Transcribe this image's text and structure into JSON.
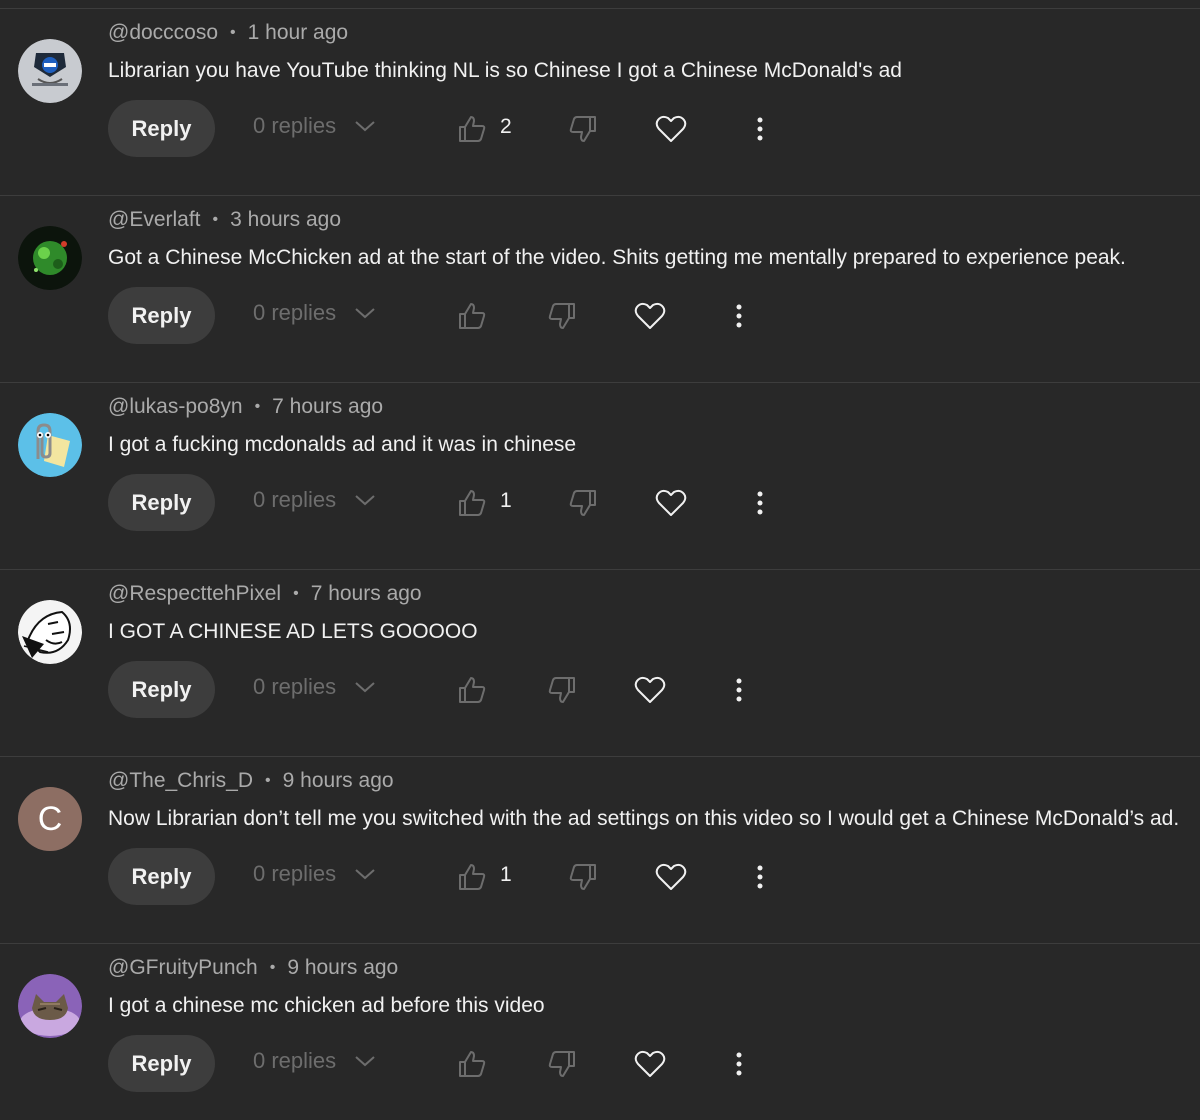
{
  "comments": [
    {
      "avatar_icon": "captain-badge-avatar-icon",
      "username": "@docccoso",
      "separator": "•",
      "time": "1 hour ago",
      "text": "Librarian you have YouTube thinking NL is so Chinese I got a Chinese McDonald's ad",
      "reply_label": "Reply",
      "replies_label": "0 replies",
      "likes": "2"
    },
    {
      "avatar_icon": "green-planet-avatar-icon",
      "username": "@Everlaft",
      "separator": "•",
      "time": "3 hours ago",
      "text": "Got a Chinese McChicken ad at the start of the video. Shits getting me mentally prepared to experience peak.",
      "reply_label": "Reply",
      "replies_label": "0 replies",
      "likes": ""
    },
    {
      "avatar_icon": "paperclip-avatar-icon",
      "username": "@lukas-po8yn",
      "separator": "•",
      "time": "7 hours ago",
      "text": "I got a fucking mcdonalds ad and it was in chinese",
      "reply_label": "Reply",
      "replies_label": "0 replies",
      "likes": "1"
    },
    {
      "avatar_icon": "sketch-face-avatar-icon",
      "username": "@RespecttehPixel",
      "separator": "•",
      "time": "7 hours ago",
      "text": "I GOT A CHINESE AD LETS GOOOOO",
      "reply_label": "Reply",
      "replies_label": "0 replies",
      "likes": ""
    },
    {
      "avatar_icon": "letter-avatar-icon",
      "avatar_letter": "C",
      "username": "@The_Chris_D",
      "separator": "•",
      "time": "9 hours ago",
      "text": "Now Librarian don’t tell me you switched with the ad settings on this video so I would get a Chinese McDonald’s ad.",
      "reply_label": "Reply",
      "replies_label": "0 replies",
      "likes": "1"
    },
    {
      "avatar_icon": "cat-avatar-icon",
      "username": "@GFruityPunch",
      "separator": "•",
      "time": "9 hours ago",
      "text": "I got a chinese mc chicken ad before this video",
      "reply_label": "Reply",
      "replies_label": "0 replies",
      "likes": ""
    }
  ],
  "colors": {
    "background": "#282828",
    "divider": "#3d3d3d",
    "reply_button": "#3d3d3d",
    "text_primary": "#f1f1f1",
    "text_secondary": "#aaaaaa",
    "icon_dim": "#6d6d6d",
    "letter_avatar": "#8d6e63"
  }
}
